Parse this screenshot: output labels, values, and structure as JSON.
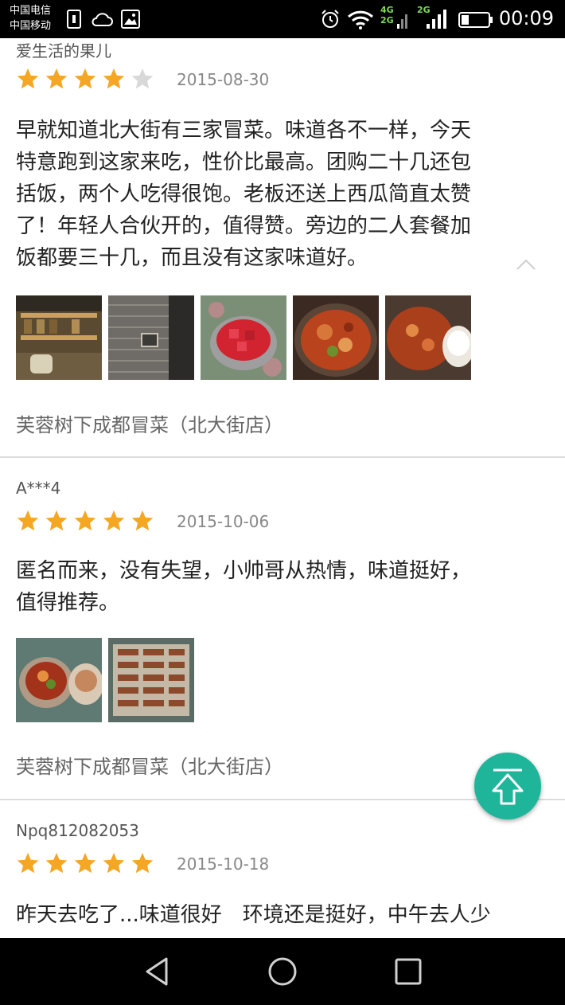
{
  "status_bar": {
    "carrier_1": "中国电信",
    "carrier_2": "中国移动",
    "network_1": "4G",
    "network_2": "2G",
    "network_3": "2G",
    "time": "00:09"
  },
  "reviews": [
    {
      "username": "爱生活的果儿",
      "rating": 4,
      "date": "2015-08-30",
      "lines": [
        "早就知道北大街有三家冒菜。味道各不一样，今天",
        "特意跑到这家来吃，性价比最高。团购二十几还包",
        "括饭，两个人吃得很饱。老板还送上西瓜简直太赞",
        "了！年轻人合伙开的，值得赞。旁边的二人套餐加",
        "饭都要三十几，而且没有这家味道好。"
      ],
      "photos": [
        "restaurant-shelves-photo",
        "brick-wall-photo",
        "watermelon-bowl-photo",
        "spicy-stew-photo",
        "stew-and-rice-photo"
      ],
      "shop": "芙蓉树下成都冒菜（北大街店）"
    },
    {
      "username": "A***4",
      "rating": 5,
      "date": "2015-10-06",
      "lines": [
        "匿名而来，没有失望，小帅哥从热情，味道挺好，",
        "值得推荐。"
      ],
      "photos": [
        "stew-bowls-photo",
        "menu-board-photo"
      ],
      "shop": "芙蓉树下成都冒菜（北大街店）"
    },
    {
      "username": "Npq812082053",
      "rating": 5,
      "date": "2015-10-18",
      "lines": [
        "昨天去吃了...味道很好　环境还是挺好，中午去人少"
      ]
    }
  ],
  "colors": {
    "star_filled": "#f5a623",
    "star_empty": "#d8d8d8",
    "accent_button": "#1fb59b"
  },
  "icons": {
    "floating_button": "back-to-top-icon",
    "nav_back": "back-triangle-icon",
    "nav_home": "home-circle-icon",
    "nav_recent": "recent-apps-square-icon"
  }
}
